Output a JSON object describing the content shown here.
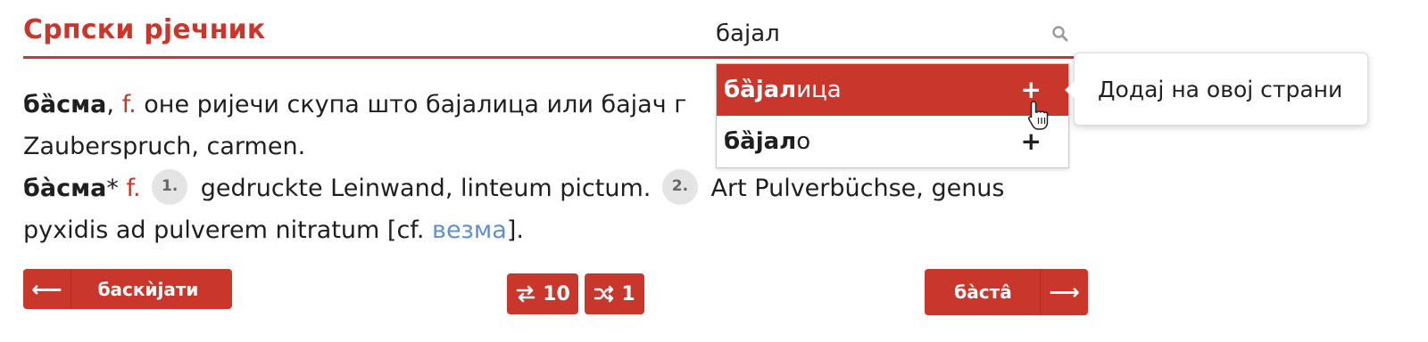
{
  "header": {
    "site_title": "Српски рјечник",
    "search_value": "бајал"
  },
  "icons": {
    "search": "search-icon",
    "add": "plus-icon",
    "prev": "arrow-left-icon",
    "next": "arrow-right-icon",
    "list": "swap-arrows-icon",
    "random": "shuffle-icon",
    "cursor": "hand-pointer-icon"
  },
  "entry": {
    "e1_headword": "ба̏сма",
    "e1_comma": ",",
    "e1_gender": "f.",
    "e1_def_pre": "оне ријечи скупа што бајалица или бајач г",
    "e1_def_post": "Zauberspruch, carmen.",
    "e2_headword": "ба̀сма",
    "e2_mark": "*",
    "e2_gender": "f.",
    "e2_sense1_num": "1.",
    "e2_sense1_text": "gedruckte Leinwand, linteum pictum.",
    "e2_sense2_num": "2.",
    "e2_sense2_text": "Art Pulverbüchse, genus pyxidis ad pulverem nitratum [cf.",
    "e2_xref": "везма",
    "e2_tail": "]."
  },
  "suggestions": [
    {
      "bold": "ба̏јал",
      "rest": "ица",
      "plus": "+",
      "active": true
    },
    {
      "bold": "ба̏јал",
      "rest": "о",
      "plus": "+",
      "active": false
    }
  ],
  "tooltip": {
    "text": "Додај на овој страни"
  },
  "nav": {
    "prev_arrow": "⟵",
    "prev_label": "баскѝјати",
    "list_count": "10",
    "random_count": "1",
    "next_label": "ба̀ста̂",
    "next_arrow": "⟶"
  },
  "colors": {
    "accent": "#c9362c",
    "link": "#5e8fcf",
    "badge_bg": "#e4e4e4"
  }
}
